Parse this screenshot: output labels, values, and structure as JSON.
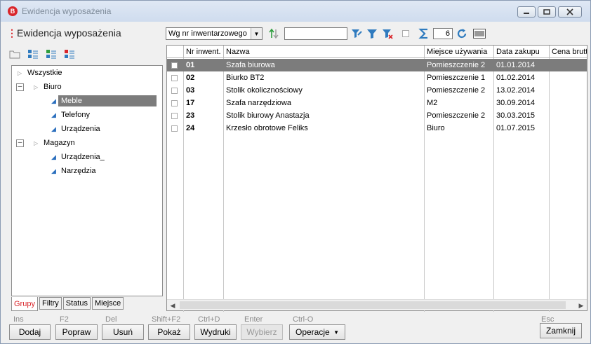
{
  "window": {
    "title": "Ewidencja wyposażenia",
    "app_badge": "B",
    "accent": "#d9262b"
  },
  "toolbar": {
    "menu_glyph": "⋮",
    "module_title": "Ewidencja wyposażenia",
    "sort_select": "Wg nr inwentarzowego",
    "search_value": "",
    "count": "6"
  },
  "tree": {
    "nodes": [
      {
        "label": "Wszystkie"
      },
      {
        "label": "Biuro"
      },
      {
        "label": "Meble",
        "selected": true
      },
      {
        "label": "Telefony"
      },
      {
        "label": "Urządzenia"
      },
      {
        "label": "Magazyn"
      },
      {
        "label": "Urządzenia_"
      },
      {
        "label": "Narzędzia"
      }
    ]
  },
  "left_tabs": [
    "Grupy",
    "Filtry",
    "Status",
    "Miejsce"
  ],
  "grid": {
    "columns": [
      "Nr inwent.",
      "Nazwa",
      "Miejsce używania",
      "Data zakupu",
      "Cena brutto"
    ],
    "rows": [
      {
        "nr": "01",
        "nazwa": "Szafa biurowa",
        "miejsce": "Pomieszczenie 2",
        "data": "01.01.2014",
        "selected": true
      },
      {
        "nr": "02",
        "nazwa": "Biurko BT2",
        "miejsce": "Pomieszczenie 1",
        "data": "01.02.2014"
      },
      {
        "nr": "03",
        "nazwa": "Stolik okolicznościowy",
        "miejsce": "Pomieszczenie 2",
        "data": "13.02.2014"
      },
      {
        "nr": "17",
        "nazwa": "Szafa narzędziowa",
        "miejsce": "M2",
        "data": "30.09.2014"
      },
      {
        "nr": "23",
        "nazwa": "Stolik biurowy Anastazja",
        "miejsce": "Pomieszczenie 2",
        "data": "30.03.2015"
      },
      {
        "nr": "24",
        "nazwa": "Krzesło obrotowe Feliks",
        "miejsce": "Biuro",
        "data": "01.07.2015"
      }
    ]
  },
  "buttons": {
    "dodaj": {
      "shortcut": "Ins",
      "label": "Dodaj"
    },
    "popraw": {
      "shortcut": "F2",
      "label": "Popraw"
    },
    "usun": {
      "shortcut": "Del",
      "label": "Usuń"
    },
    "pokaz": {
      "shortcut": "Shift+F2",
      "label": "Pokaż"
    },
    "wydruki": {
      "shortcut": "Ctrl+D",
      "label": "Wydruki"
    },
    "wybierz": {
      "shortcut": "Enter",
      "label": "Wybierz"
    },
    "operacje": {
      "shortcut": "Ctrl-O",
      "label": "Operacje"
    },
    "zamknij": {
      "shortcut": "Esc",
      "label": "Zamknij"
    }
  }
}
